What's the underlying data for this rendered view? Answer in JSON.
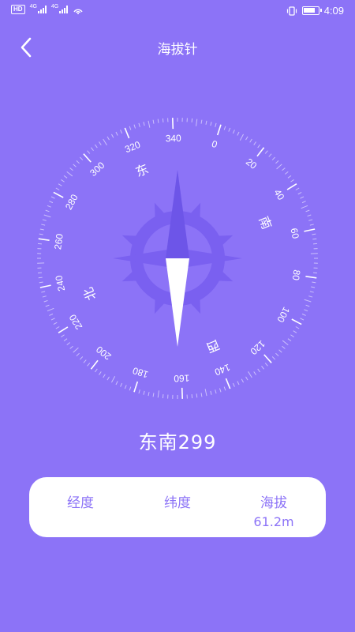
{
  "status_bar": {
    "hd": "HD",
    "net1": "4G",
    "net2": "4G",
    "time": "4:09"
  },
  "header": {
    "title": "海拔针",
    "back_icon": "chevron-left-icon"
  },
  "compass": {
    "degree_labels": [
      "0",
      "20",
      "40",
      "60",
      "80",
      "100",
      "120",
      "140",
      "160",
      "180",
      "200",
      "220",
      "240",
      "260",
      "280",
      "300",
      "320",
      "340"
    ],
    "direction_labels": {
      "north": "北",
      "east": "东",
      "south": "南",
      "west": "西"
    },
    "colors": {
      "needle_north": "#6d55e8",
      "needle_south": "#ffffff",
      "rose": "#7a60f0",
      "ring": "#8c73f7"
    }
  },
  "direction_readout": "东南299",
  "info_card": {
    "longitude": {
      "label": "经度",
      "value": ""
    },
    "latitude": {
      "label": "纬度",
      "value": ""
    },
    "altitude": {
      "label": "海拔",
      "value": "61.2m"
    }
  },
  "colors": {
    "background": "#8c73f7",
    "accent": "#8c73f7"
  }
}
